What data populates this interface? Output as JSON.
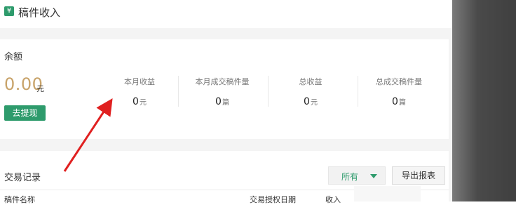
{
  "header": {
    "icon": "yen-icon",
    "icon_glyph": "¥",
    "title": "稿件收入"
  },
  "balance": {
    "label": "余额",
    "amount": "0.00",
    "unit": "元",
    "withdraw_label": "去提现",
    "stats": [
      {
        "label": "本月收益",
        "value": "0",
        "unit": "元"
      },
      {
        "label": "本月成交稿件量",
        "value": "0",
        "unit": "篇"
      },
      {
        "label": "总收益",
        "value": "0",
        "unit": "元"
      },
      {
        "label": "总成交稿件量",
        "value": "0",
        "unit": "篇"
      }
    ]
  },
  "transactions": {
    "title": "交易记录",
    "filter": {
      "selected": "所有"
    },
    "export_label": "导出报表",
    "columns": [
      "稿件名称",
      "交易授权日期",
      "收入"
    ]
  },
  "colors": {
    "accent": "#2e9b6c",
    "amount": "#c8a36a",
    "annotation_arrow": "#e02020"
  }
}
